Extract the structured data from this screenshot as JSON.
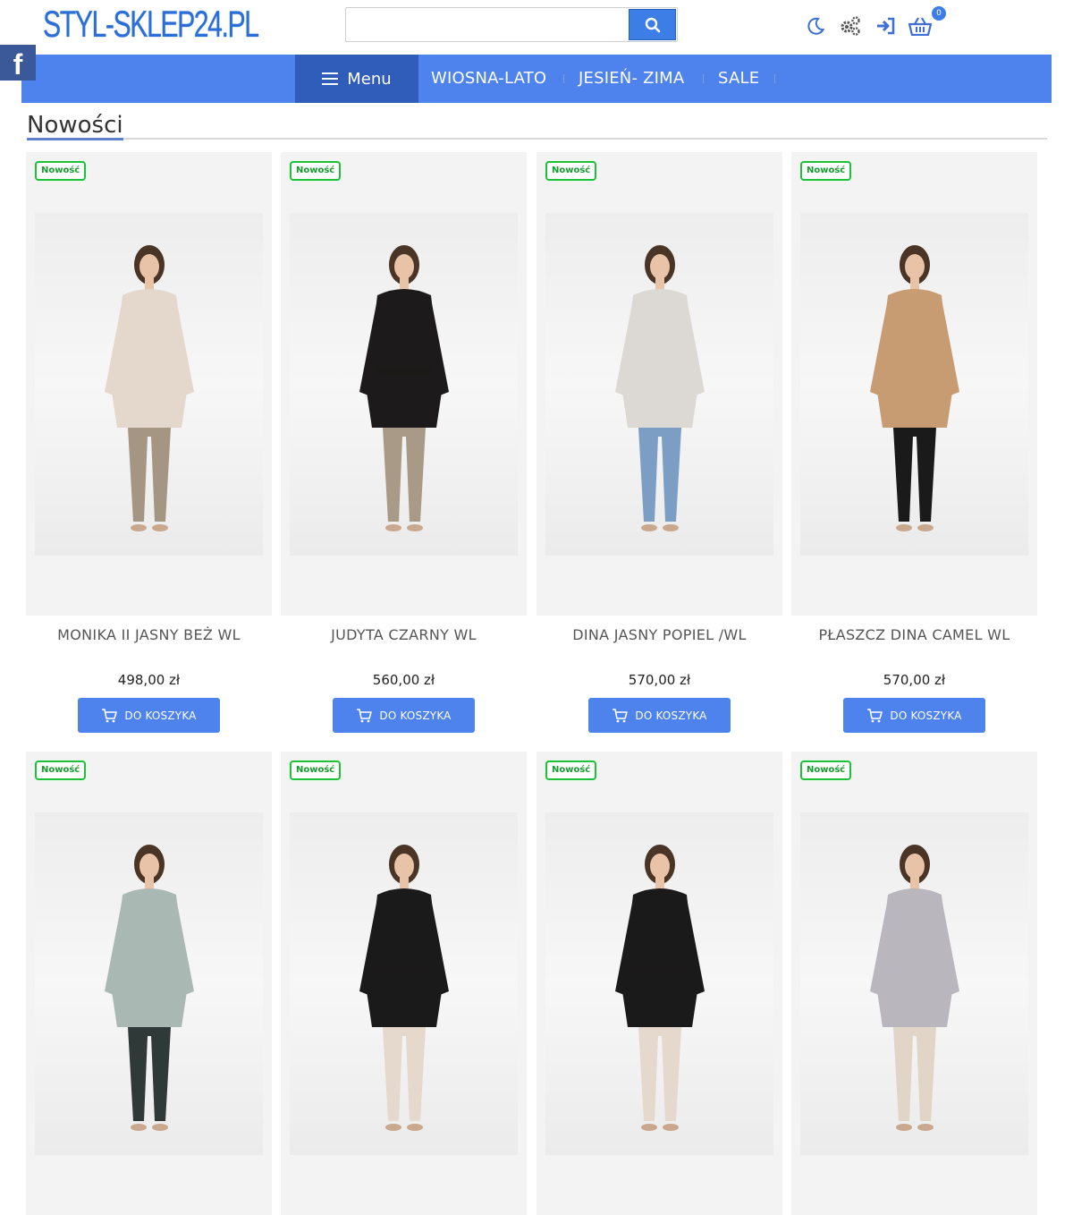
{
  "header": {
    "logo_text": "STYL-SKLEP24.PL",
    "search_placeholder": "",
    "cart_count": "0",
    "icons": [
      "moon-icon",
      "settings-gears-icon",
      "login-icon",
      "basket-icon"
    ]
  },
  "social": {
    "facebook_label": "f"
  },
  "nav": {
    "menu_label": "Menu",
    "links": [
      "WIOSNA-LATO",
      "JESIEŃ- ZIMA",
      "SALE"
    ]
  },
  "section": {
    "title": "Nowości"
  },
  "colors": {
    "accent": "#4e82ec",
    "nav_dark": "#2f5db9",
    "badge_green": "#1fbf3a",
    "facebook": "#3b5998"
  },
  "products": [
    {
      "badge": "Nowość",
      "name": "MONIKA II JASNY BEŻ WL",
      "price": "498,00 zł",
      "button": "DO KOSZYKA",
      "coat": "#e4d7cb",
      "pants": "#a59684"
    },
    {
      "badge": "Nowość",
      "name": "JUDYTA CZARNY WL",
      "price": "560,00 zł",
      "button": "DO KOSZYKA",
      "coat": "#1c1a1a",
      "pants": "#a89a86"
    },
    {
      "badge": "Nowość",
      "name": "DINA JASNY POPIEL /WL",
      "price": "570,00 zł",
      "button": "DO KOSZYKA",
      "coat": "#dcd8d3",
      "pants": "#7c9ec4"
    },
    {
      "badge": "Nowość",
      "name": "PŁASZCZ DINA CAMEL WL",
      "price": "570,00 zł",
      "button": "DO KOSZYKA",
      "coat": "#c79c73",
      "pants": "#1a1a1a"
    },
    {
      "badge": "Nowość",
      "name": "",
      "price": "",
      "button": "",
      "coat": "#aab8b3",
      "pants": "#2f3a38"
    },
    {
      "badge": "Nowość",
      "name": "",
      "price": "",
      "button": "",
      "coat": "#1b1a1a",
      "pants": "#e4d9cc"
    },
    {
      "badge": "Nowość",
      "name": "",
      "price": "",
      "button": "",
      "coat": "#1b1a1a",
      "pants": "#e4d9cc"
    },
    {
      "badge": "Nowość",
      "name": "",
      "price": "",
      "button": "",
      "coat": "#b9b6bd",
      "pants": "#e0d5c6"
    }
  ]
}
